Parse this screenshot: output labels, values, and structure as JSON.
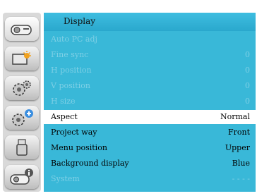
{
  "menu": {
    "title": "Display",
    "items": [
      {
        "label": "Auto PC adj",
        "value": "",
        "state": "disabled"
      },
      {
        "label": "Fine sync",
        "value": "0",
        "state": "disabled"
      },
      {
        "label": "H position",
        "value": "0",
        "state": "disabled"
      },
      {
        "label": "V position",
        "value": "0",
        "state": "disabled"
      },
      {
        "label": "H size",
        "value": "0",
        "state": "disabled"
      },
      {
        "label": "Aspect",
        "value": "Normal",
        "state": "selected"
      },
      {
        "label": "Project way",
        "value": "Front",
        "state": "enabled"
      },
      {
        "label": "Menu position",
        "value": "Upper",
        "state": "enabled"
      },
      {
        "label": "Background display",
        "value": "Blue",
        "state": "enabled"
      },
      {
        "label": "System",
        "value": "- - - -",
        "state": "disabled"
      }
    ]
  },
  "sidebar": {
    "tabs": [
      {
        "icon": "projector-icon",
        "active": true
      },
      {
        "icon": "image-settings-icon",
        "active": false
      },
      {
        "icon": "gears-icon",
        "active": false
      },
      {
        "icon": "expand-gears-icon",
        "active": false
      },
      {
        "icon": "usb-icon",
        "active": false
      },
      {
        "icon": "projector-info-icon",
        "active": false
      }
    ]
  },
  "colors": {
    "panel": "#39b8d8",
    "header": "#2aa8cd",
    "selected_row": "#ffffff",
    "disabled_text": "#7fd0e6",
    "sidebar": "#d9d9d9"
  }
}
